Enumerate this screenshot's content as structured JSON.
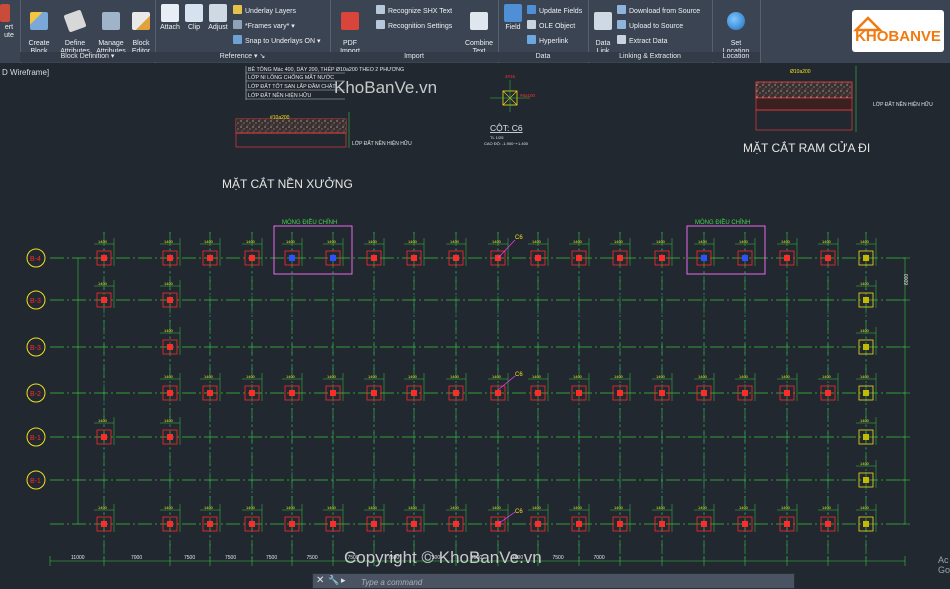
{
  "ribbon": {
    "panels": {
      "block_definition": "Block Definition",
      "reference": "Reference",
      "import": "Import",
      "data": "Data",
      "linking": "Linking & Extraction",
      "location": "Location"
    },
    "buttons": {
      "insert_partial": "ert",
      "insert_partial2": "ute",
      "create_block": "Create\nBlock",
      "define_attributes": "Define\nAttributes",
      "manage_attributes": "Manage\nAttributes",
      "block_editor": "Block\nEditor",
      "attach": "Attach",
      "clip": "Clip",
      "adjust": "Adjust",
      "underlay_layers": "Underlay Layers",
      "frames_vary": "*Frames vary*",
      "snap_underlays": "Snap to Underlays ON",
      "pdf_import": "PDF\nImport",
      "recognize_shx": "Recognize SHX Text",
      "recognition_settings": "Recognition Settings",
      "combine_text": "Combine\nText",
      "field": "Field",
      "update_fields": "Update Fields",
      "ole_object": "OLE Object",
      "hyperlink": "Hyperlink",
      "data_link": "Data\nLink",
      "download_source": "Download from Source",
      "upload_source": "Upload to Source",
      "extract_data": "Extract  Data",
      "set_location": "Set\nLocation"
    }
  },
  "logo": {
    "text": "KHOBANVE"
  },
  "viewport": {
    "label": "D Wireframe]"
  },
  "drawing": {
    "section_floor_title": "MẶT CẮT NỀN XƯỞNG",
    "section_ramp_title": "MẶT CẮT RAM CỬA ĐI",
    "notes": [
      "BÊ TÔNG Mác 400, DÀY 200, THÉP Ø10a200 THEO 2 PHƯƠNG",
      "LỚP NI LÔNG CHỐNG MẤT NƯỚC",
      "LỚP ĐẤT TỐT SAN LẤP ĐẦM CHẶT",
      "LỚP ĐẤT NỀN HIỆN HỮU"
    ],
    "note_floor_bottom": "LỚP ĐẤT NỀN HIỆN HỮU",
    "note_ramp": "LỚP ĐẤT NỀN HIỆN HỮU",
    "column_title": "CỘT: C6",
    "column_scale": "TL  1/25",
    "column_sub": "CAO ĐỘ: -1.900~+1.400",
    "foundation_label_1": "MÓNG ĐIỀU CHỈNH",
    "foundation_label_2": "MÓNG ĐIỀU CHỈNH",
    "column_tag": "C6",
    "grid_bubbles_left": [
      "B-4",
      "B-3",
      "B-3",
      "B-2",
      "B-1",
      "B-1"
    ],
    "dims_bottom": [
      "11000",
      "7000",
      "7500",
      "7500",
      "7500",
      "7500",
      "7500",
      "7500",
      "7500",
      "7500",
      "7500",
      "7500",
      "7000"
    ],
    "dim_right": "6000",
    "dim_top_col": "1400"
  },
  "watermarks": {
    "top": "KhoBanVe.vn",
    "bottom": "Copyright © KhoBanVe.vn"
  },
  "command_line": {
    "close_glyph": "✕",
    "wrench_glyph": "🔧",
    "prompt_glyph": "▸",
    "placeholder": "Type a command"
  },
  "corner_text": {
    "line1": "Ac",
    "line2": "Go"
  },
  "colors": {
    "grid_green": "#39c43d",
    "axis_cyan": "#19d4e0",
    "column_red": "#ff2a2a",
    "bubble_yellow": "#f0e020",
    "magenta": "#ff3cff",
    "text_white": "#e6e6e6",
    "label_green": "#46d64a"
  }
}
